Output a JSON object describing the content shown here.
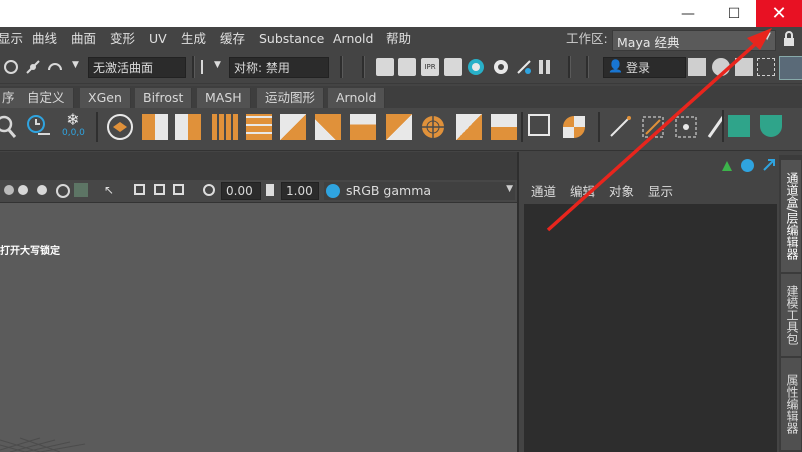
{
  "window": {
    "minimize_glyph": "—",
    "maximize_glyph": "☐",
    "close_glyph": "✕"
  },
  "menu": {
    "items": [
      "显示",
      "曲线",
      "曲面",
      "变形",
      "UV",
      "生成",
      "缓存",
      "Substance",
      "Arnold",
      "帮助"
    ],
    "workspace_label": "工作区:",
    "workspace_value": "Maya 经典"
  },
  "statusline": {
    "surface_field": "无激活曲面",
    "symmetry_field": "对称: 禁用",
    "login_label": "登录",
    "snap_values": "0,0,0"
  },
  "shelf_tabs": [
    "序",
    "自定义",
    "XGen",
    "Bifrost",
    "MASH",
    "运动图形",
    "Arnold"
  ],
  "viewport": {
    "exposure_value": "0.00",
    "gamma_value": "1.00",
    "color_space": "sRGB gamma",
    "overlay_text": "打开大写锁定"
  },
  "channel_box": {
    "tabs": [
      "通道",
      "编辑",
      "对象",
      "显示"
    ]
  },
  "side_tabs": [
    "通道盒/层编辑器",
    "建模工具包",
    "属性编辑器"
  ],
  "colors": {
    "accent_red": "#e81123",
    "annotation_arrow": "#e8251d",
    "maya_orange": "#e0913a",
    "panel_bg": "#444444",
    "viewport_bg": "#5b5b5b"
  }
}
